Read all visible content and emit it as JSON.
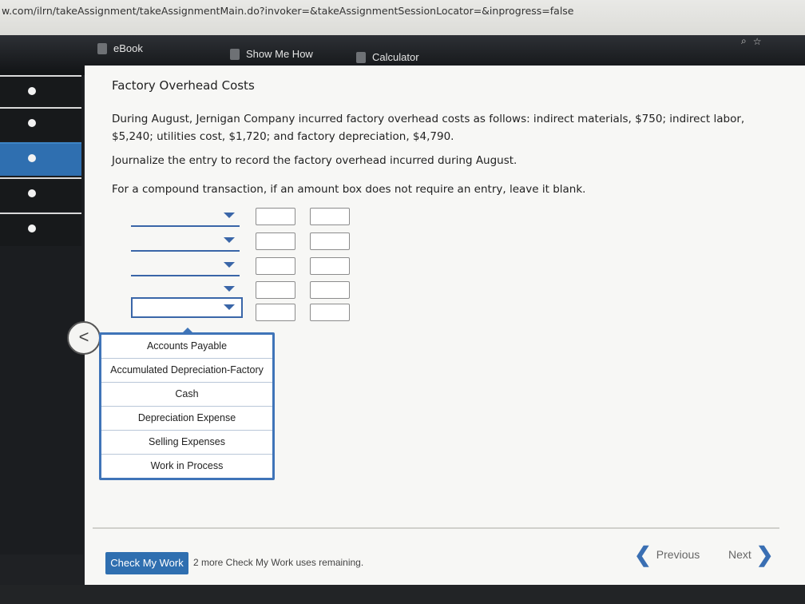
{
  "browser": {
    "url": "w.com/ilrn/takeAssignment/takeAssignmentMain.do?invoker=&takeAssignmentSessionLocator=&inprogress=false"
  },
  "toolbar": {
    "ebook": "eBook",
    "show_me_how": "Show Me How",
    "calculator": "Calculator"
  },
  "problem": {
    "title": "Factory Overhead Costs",
    "statement": "During August, Jernigan Company incurred factory overhead costs as follows: indirect materials, $750; indirect labor, $5,240; utilities cost, $1,720; and factory depreciation, $4,790.",
    "instruction": "Journalize the entry to record the factory overhead incurred during August.",
    "note": "For a compound transaction, if an amount box does not require an entry, leave it blank."
  },
  "journal": {
    "rows": [
      {
        "account": "",
        "debit": "",
        "credit": ""
      },
      {
        "account": "",
        "debit": "",
        "credit": ""
      },
      {
        "account": "",
        "debit": "",
        "credit": ""
      },
      {
        "account": "",
        "debit": "",
        "credit": ""
      },
      {
        "account": "",
        "debit": "",
        "credit": ""
      }
    ]
  },
  "dropdown": {
    "options": [
      "Accounts Payable",
      "Accumulated Depreciation-Factory",
      "Cash",
      "Depreciation Expense",
      "Selling Expenses",
      "Work in Process"
    ]
  },
  "footer": {
    "check_my_work": "Check My Work",
    "remaining": "2 more Check My Work uses remaining.",
    "previous": "Previous",
    "next": "Next"
  }
}
